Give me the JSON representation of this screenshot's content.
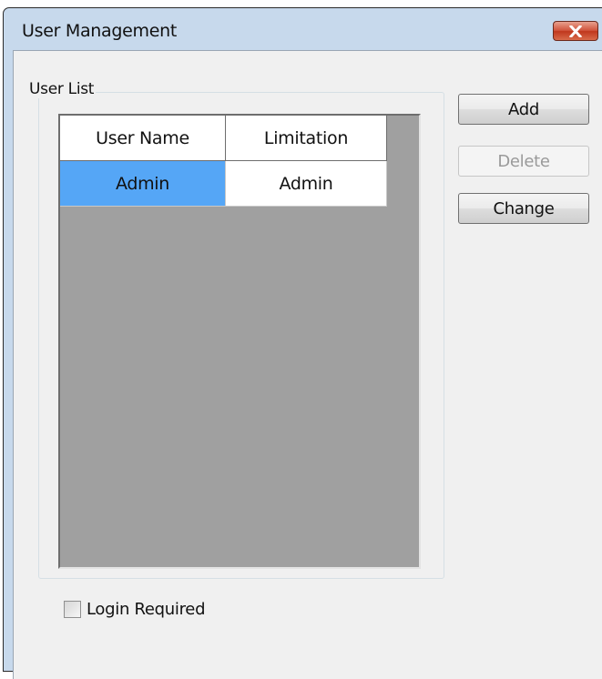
{
  "window": {
    "title": "User Management",
    "close_icon": "close-x-icon"
  },
  "group": {
    "label": "User List"
  },
  "table": {
    "headers": [
      "User Name",
      "Limitation"
    ],
    "rows": [
      {
        "user_name": "Admin",
        "limitation": "Admin",
        "selected_cell": "user_name"
      }
    ]
  },
  "buttons": {
    "add": "Add",
    "delete": "Delete",
    "change": "Change"
  },
  "login_required": {
    "label": "Login Required",
    "checked": false
  },
  "colors": {
    "selection": "#55a6f6",
    "grid_background": "#a0a0a0",
    "dialog_background": "#f0f0f0",
    "titlebar": "#c7d9ec",
    "close_button": "#c0371d"
  }
}
